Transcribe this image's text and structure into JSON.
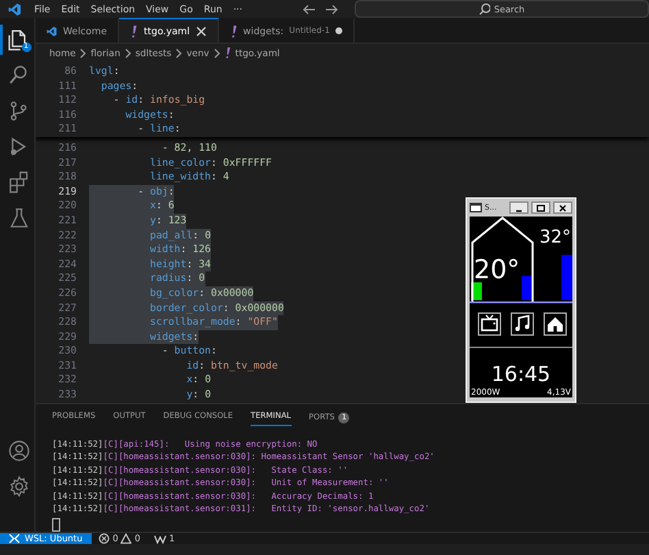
{
  "menu": [
    "File",
    "Edit",
    "Selection",
    "View",
    "Go",
    "Run",
    "···"
  ],
  "search": {
    "placeholder": "Search"
  },
  "activity_bar": [
    {
      "kind": "explorer",
      "selected": true,
      "badge": "1"
    },
    {
      "kind": "search",
      "selected": false
    },
    {
      "kind": "source-control",
      "selected": false
    },
    {
      "kind": "run",
      "selected": false
    },
    {
      "kind": "extensions",
      "selected": false
    },
    {
      "kind": "testing",
      "selected": false
    }
  ],
  "activity_bottom": [
    {
      "kind": "account"
    },
    {
      "kind": "settings"
    }
  ],
  "tabs": [
    {
      "kind": "welcome",
      "label": "Welcome",
      "selected": false,
      "modified": false
    },
    {
      "kind": "yaml",
      "label": "ttgo.yaml",
      "selected": true,
      "modified": false
    },
    {
      "kind": "yaml",
      "label": "widgets:",
      "description": "Untitled-1",
      "selected": false,
      "modified": true
    }
  ],
  "breadcrumb": [
    "home",
    "florian",
    "sdltests",
    "venv",
    "ttgo.yaml"
  ],
  "sticky_lines": [
    {
      "num": "86",
      "current": false,
      "selected": false,
      "code": [
        {
          "kind": "key",
          "t": "lvgl"
        },
        {
          "kind": "p",
          "t": ":"
        }
      ]
    },
    {
      "num": "111",
      "current": false,
      "selected": false,
      "code": [
        {
          "kind": "key",
          "t": "  pages"
        },
        {
          "kind": "p",
          "t": ":"
        }
      ]
    },
    {
      "num": "112",
      "current": false,
      "selected": false,
      "code": [
        {
          "kind": "p",
          "t": "    - "
        },
        {
          "kind": "key",
          "t": "id"
        },
        {
          "kind": "p",
          "t": ": "
        },
        {
          "kind": "str",
          "t": "infos_big"
        }
      ]
    },
    {
      "num": "116",
      "current": false,
      "selected": false,
      "code": [
        {
          "kind": "key",
          "t": "      widgets"
        },
        {
          "kind": "p",
          "t": ":"
        }
      ]
    },
    {
      "num": "211",
      "current": false,
      "selected": false,
      "code": [
        {
          "kind": "p",
          "t": "        - "
        },
        {
          "kind": "key",
          "t": "line"
        },
        {
          "kind": "p",
          "t": ":"
        }
      ]
    }
  ],
  "lines": [
    {
      "num": "216",
      "current": false,
      "selected": false,
      "code": [
        {
          "kind": "p",
          "t": "            - "
        },
        {
          "kind": "num",
          "t": "82"
        },
        {
          "kind": "p",
          "t": ", "
        },
        {
          "kind": "num",
          "t": "110"
        }
      ]
    },
    {
      "num": "217",
      "current": false,
      "selected": false,
      "code": [
        {
          "kind": "key",
          "t": "          line_color"
        },
        {
          "kind": "p",
          "t": ": "
        },
        {
          "kind": "num",
          "t": "0xFFFFFF"
        }
      ]
    },
    {
      "num": "218",
      "current": false,
      "selected": false,
      "code": [
        {
          "kind": "key",
          "t": "          line_width"
        },
        {
          "kind": "p",
          "t": ": "
        },
        {
          "kind": "num",
          "t": "4"
        }
      ]
    },
    {
      "num": "219",
      "current": true,
      "selected": true,
      "code": [
        {
          "kind": "p",
          "t": "        - "
        },
        {
          "kind": "key",
          "t": "obj"
        },
        {
          "kind": "p",
          "t": ":"
        }
      ]
    },
    {
      "num": "220",
      "current": false,
      "selected": true,
      "code": [
        {
          "kind": "key",
          "t": "          x"
        },
        {
          "kind": "p",
          "t": ": "
        },
        {
          "kind": "num",
          "t": "6"
        }
      ]
    },
    {
      "num": "221",
      "current": false,
      "selected": true,
      "code": [
        {
          "kind": "key",
          "t": "          y"
        },
        {
          "kind": "p",
          "t": ": "
        },
        {
          "kind": "num",
          "t": "123"
        }
      ]
    },
    {
      "num": "222",
      "current": false,
      "selected": true,
      "code": [
        {
          "kind": "key",
          "t": "          pad_all"
        },
        {
          "kind": "p",
          "t": ": "
        },
        {
          "kind": "num",
          "t": "0"
        }
      ]
    },
    {
      "num": "223",
      "current": false,
      "selected": true,
      "code": [
        {
          "kind": "key",
          "t": "          width"
        },
        {
          "kind": "p",
          "t": ": "
        },
        {
          "kind": "num",
          "t": "126"
        }
      ]
    },
    {
      "num": "224",
      "current": false,
      "selected": true,
      "code": [
        {
          "kind": "key",
          "t": "          height"
        },
        {
          "kind": "p",
          "t": ": "
        },
        {
          "kind": "num",
          "t": "34"
        }
      ]
    },
    {
      "num": "225",
      "current": false,
      "selected": true,
      "code": [
        {
          "kind": "key",
          "t": "          radius"
        },
        {
          "kind": "p",
          "t": ": "
        },
        {
          "kind": "num",
          "t": "0"
        }
      ]
    },
    {
      "num": "226",
      "current": false,
      "selected": true,
      "code": [
        {
          "kind": "key",
          "t": "          bg_color"
        },
        {
          "kind": "p",
          "t": ": "
        },
        {
          "kind": "num",
          "t": "0x00000"
        }
      ]
    },
    {
      "num": "227",
      "current": false,
      "selected": true,
      "code": [
        {
          "kind": "key",
          "t": "          border_color"
        },
        {
          "kind": "p",
          "t": ": "
        },
        {
          "kind": "num",
          "t": "0x000000"
        }
      ]
    },
    {
      "num": "228",
      "current": false,
      "selected": true,
      "code": [
        {
          "kind": "key",
          "t": "          scrollbar_mode"
        },
        {
          "kind": "p",
          "t": ": "
        },
        {
          "kind": "str",
          "t": "\"OFF\""
        }
      ]
    },
    {
      "num": "229",
      "current": false,
      "selected": true,
      "code": [
        {
          "kind": "key",
          "t": "          widgets"
        },
        {
          "kind": "p",
          "t": ":"
        }
      ]
    },
    {
      "num": "230",
      "current": false,
      "selected": false,
      "code": [
        {
          "kind": "p",
          "t": "            - "
        },
        {
          "kind": "key",
          "t": "button"
        },
        {
          "kind": "p",
          "t": ":"
        }
      ]
    },
    {
      "num": "231",
      "current": false,
      "selected": false,
      "code": [
        {
          "kind": "key",
          "t": "                id"
        },
        {
          "kind": "p",
          "t": ": "
        },
        {
          "kind": "str",
          "t": "btn_tv_mode"
        }
      ]
    },
    {
      "num": "232",
      "current": false,
      "selected": false,
      "code": [
        {
          "kind": "key",
          "t": "                x"
        },
        {
          "kind": "p",
          "t": ": "
        },
        {
          "kind": "num",
          "t": "0"
        }
      ]
    },
    {
      "num": "233",
      "current": false,
      "selected": false,
      "code": [
        {
          "kind": "key",
          "t": "                y"
        },
        {
          "kind": "p",
          "t": ": "
        },
        {
          "kind": "num",
          "t": "0"
        }
      ]
    }
  ],
  "emulator": {
    "title": "S...",
    "temperature_inside": "20°",
    "temperature_outside": "32°",
    "bars": [
      {
        "color": "#00dd00",
        "level": 0.22
      },
      {
        "color": "#0000ff",
        "level": 0.3
      },
      {
        "color": "#0000ff",
        "level": 0.56
      }
    ],
    "buttons": [
      {
        "kind": "tv"
      },
      {
        "kind": "music"
      },
      {
        "kind": "home"
      }
    ],
    "time": "16:45",
    "power": "2000W",
    "voltage": "4,13V"
  },
  "panel": {
    "tabs": [
      {
        "label": "PROBLEMS",
        "selected": false
      },
      {
        "label": "OUTPUT",
        "selected": false
      },
      {
        "label": "DEBUG CONSOLE",
        "selected": false
      },
      {
        "label": "TERMINAL",
        "selected": true
      },
      {
        "label": "PORTS",
        "selected": false,
        "badge": "1"
      }
    ],
    "terminal": [
      {
        "time": "[14:11:52]",
        "message": "[C][api:145]:   Using noise encryption: NO"
      },
      {
        "time": "[14:11:52]",
        "message": "[C][homeassistant.sensor:030]: Homeassistant Sensor 'hallway_co2'"
      },
      {
        "time": "[14:11:52]",
        "message": "[C][homeassistant.sensor:030]:   State Class: ''"
      },
      {
        "time": "[14:11:52]",
        "message": "[C][homeassistant.sensor:030]:   Unit of Measurement: ''"
      },
      {
        "time": "[14:11:52]",
        "message": "[C][homeassistant.sensor:030]:   Accuracy Decimals: 1"
      },
      {
        "time": "[14:11:52]",
        "message": "[C][homeassistant.sensor:031]:   Entity ID: 'sensor.hallway_co2'"
      }
    ]
  },
  "status_bar": {
    "remote": "WSL: Ubuntu",
    "errors": "0",
    "warnings": "0",
    "ports": "1"
  }
}
